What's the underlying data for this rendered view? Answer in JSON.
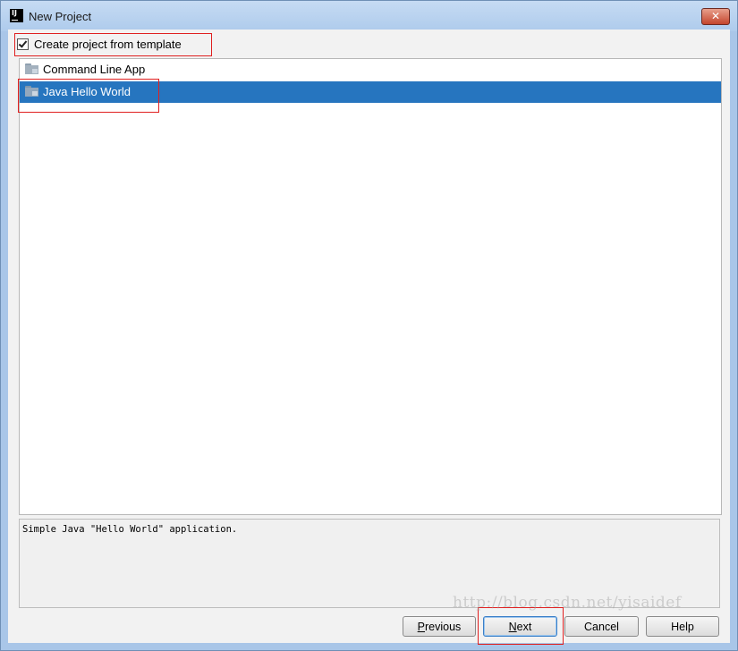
{
  "window": {
    "title": "New Project",
    "close_icon": "close-icon",
    "close_symbol": "✕"
  },
  "template_checkbox": {
    "label": "Create project from template",
    "checked": true
  },
  "templates": [
    {
      "label": "Command Line App",
      "icon": "folder-icon",
      "selected": false
    },
    {
      "label": "Java Hello World",
      "icon": "folder-icon",
      "selected": true
    }
  ],
  "description": "Simple Java \"Hello World\" application.",
  "buttons": {
    "previous": {
      "first": "P",
      "rest": "revious"
    },
    "next": {
      "first": "N",
      "rest": "ext"
    },
    "cancel": "Cancel",
    "help": "Help"
  },
  "watermark": "http://blog.csdn.net/yisaidef",
  "colors": {
    "selection": "#2675bf",
    "highlight_border": "#e02020",
    "titlebar": "#aecbec"
  }
}
